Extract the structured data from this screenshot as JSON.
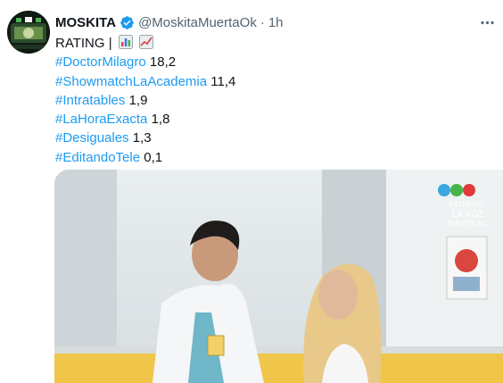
{
  "tweet": {
    "author_name": "MOSKITA",
    "handle": "@MoskitaMuertaOk",
    "separator": "·",
    "time": "1h",
    "lines": [
      {
        "text": "RATING |",
        "tag": "",
        "value": ""
      },
      {
        "tag": "#DoctorMilagro",
        "value": "18,2"
      },
      {
        "tag": "#ShowmatchLaAcademia",
        "value": "11,4"
      },
      {
        "tag": "#Intratables",
        "value": "1,9"
      },
      {
        "tag": "#LaHoraExacta",
        "value": "1,8"
      },
      {
        "tag": "#Desiguales",
        "value": "1,3"
      },
      {
        "tag": "#EditandoTele",
        "value": "0,1"
      }
    ],
    "emojis": [
      "bar-chart-emoji",
      "chart-increasing-emoji"
    ]
  },
  "media": {
    "overlay_line1": "ESTRENO",
    "overlay_line2": "LA VOZ",
    "overlay_line3": "JUEVES 24"
  },
  "colors": {
    "link": "#1d9bf0",
    "secondary_text": "#536471",
    "verified_badge": "#1d9bf0"
  },
  "icons": {
    "verified": "verified-badge-icon",
    "more": "more-options-icon"
  }
}
